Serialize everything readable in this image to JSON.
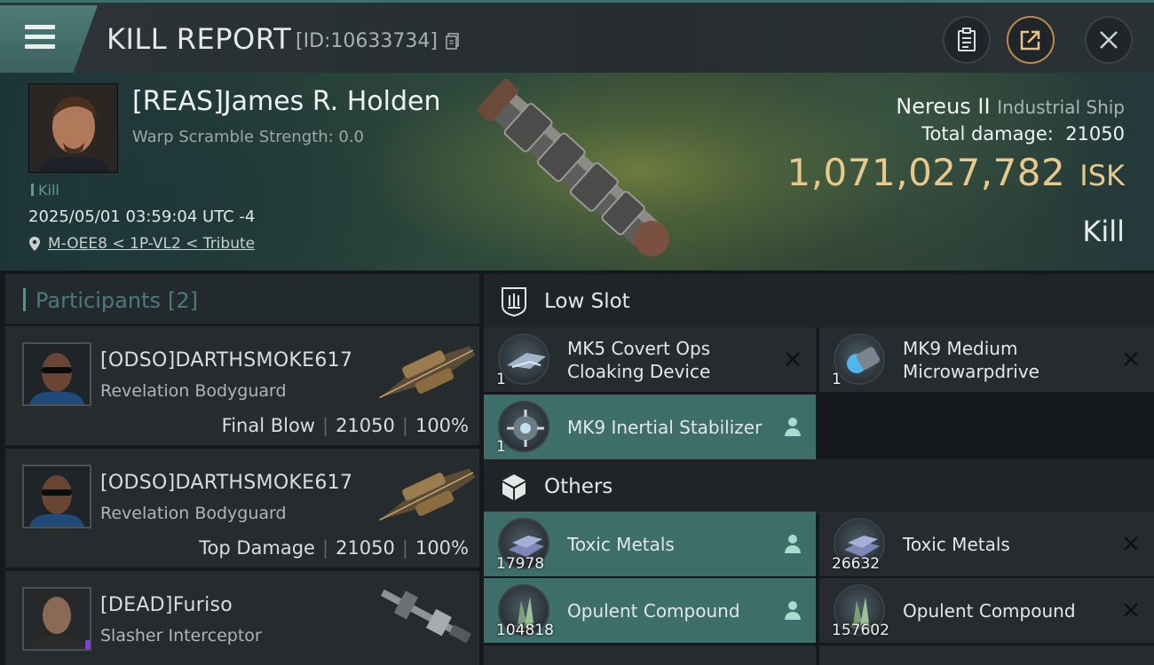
{
  "header": {
    "title": "KILL REPORT",
    "id_text": "[ID:10633734]"
  },
  "victim": {
    "name": "[REAS]James R. Holden",
    "warp_scramble": "Warp Scramble Strength: 0.0",
    "tag": "Kill",
    "timestamp": "2025/05/01 03:59:04 UTC -4",
    "location": "M-OEE8 < 1P-VL2 < Tribute",
    "ship_name": "Nereus II",
    "ship_class": "Industrial Ship",
    "total_damage_label": "Total damage:",
    "total_damage": "21050",
    "isk_value": "1,071,027,782",
    "isk_unit": "ISK",
    "result": "Kill"
  },
  "participants": {
    "label": "Participants",
    "count": "[2]",
    "list": [
      {
        "name": "[ODSO]DARTHSMOKE617",
        "ship": "Revelation Bodyguard",
        "role": "Final Blow",
        "damage": "21050",
        "percent": "100%"
      },
      {
        "name": "[ODSO]DARTHSMOKE617",
        "ship": "Revelation Bodyguard",
        "role": "Top Damage",
        "damage": "21050",
        "percent": "100%"
      },
      {
        "name": "[DEAD]Furiso",
        "ship": "Slasher Interceptor"
      }
    ]
  },
  "sections": {
    "low_slot": {
      "title": "Low Slot",
      "items": [
        {
          "name": "MK5 Covert Ops Cloaking Device",
          "qty": "1",
          "status": "destroyed"
        },
        {
          "name": "MK9 Medium Microwarpdrive",
          "qty": "1",
          "status": "destroyed"
        },
        {
          "name": "MK9 Inertial Stabilizer",
          "qty": "1",
          "status": "dropped"
        }
      ]
    },
    "others": {
      "title": "Others",
      "items": [
        {
          "name": "Toxic Metals",
          "qty": "17978",
          "status": "dropped"
        },
        {
          "name": "Toxic Metals",
          "qty": "26632",
          "status": "destroyed"
        },
        {
          "name": "Opulent Compound",
          "qty": "104818",
          "status": "dropped"
        },
        {
          "name": "Opulent Compound",
          "qty": "157602",
          "status": "destroyed"
        }
      ]
    }
  },
  "colors": {
    "accent": "#3e6e69",
    "isk": "#e7c98d",
    "panel": "#262b2e",
    "share_ring": "#b98a4a"
  }
}
